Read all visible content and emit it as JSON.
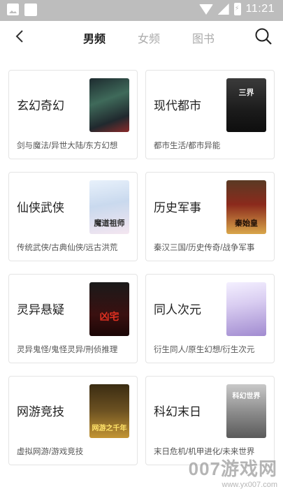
{
  "status_bar": {
    "time": "11:21",
    "icons": [
      "image-notification-icon",
      "square-notification-icon",
      "wifi-icon",
      "signal-icon",
      "battery-charging-icon"
    ]
  },
  "nav": {
    "back_icon": "chevron-left-icon",
    "tabs": [
      {
        "label": "男频",
        "active": true
      },
      {
        "label": "女频",
        "active": false
      },
      {
        "label": "图书",
        "active": false
      }
    ],
    "search_icon": "search-icon"
  },
  "categories": [
    {
      "title": "玄幻奇幻",
      "subtitle": "剑与魔法/异世大陆/东方幻想",
      "cover_text": ""
    },
    {
      "title": "现代都市",
      "subtitle": "都市生活/都市异能",
      "cover_text": "三界"
    },
    {
      "title": "仙侠武侠",
      "subtitle": "传统武侠/古典仙侠/远古洪荒",
      "cover_text": "魔道祖师"
    },
    {
      "title": "历史军事",
      "subtitle": "秦汉三国/历史传奇/战争军事",
      "cover_text": "秦始皇"
    },
    {
      "title": "灵异悬疑",
      "subtitle": "灵异鬼怪/鬼怪灵异/刑侦推理",
      "cover_text": "凶宅"
    },
    {
      "title": "同人次元",
      "subtitle": "衍生同人/原生幻想/衍生次元",
      "cover_text": ""
    },
    {
      "title": "网游竞技",
      "subtitle": "虚拟网游/游戏竞技",
      "cover_text": "网游之千年"
    },
    {
      "title": "科幻末日",
      "subtitle": "末日危机/机甲进化/未来世界",
      "cover_text": "科幻世界"
    }
  ],
  "watermark": {
    "big": "007游戏网",
    "small": "www.yx007.com"
  },
  "colors": {
    "status_bar": "#bdbdbd",
    "active_tab": "#222222",
    "inactive_tab": "#aaaaaa",
    "card_border": "#e4e4e4"
  }
}
